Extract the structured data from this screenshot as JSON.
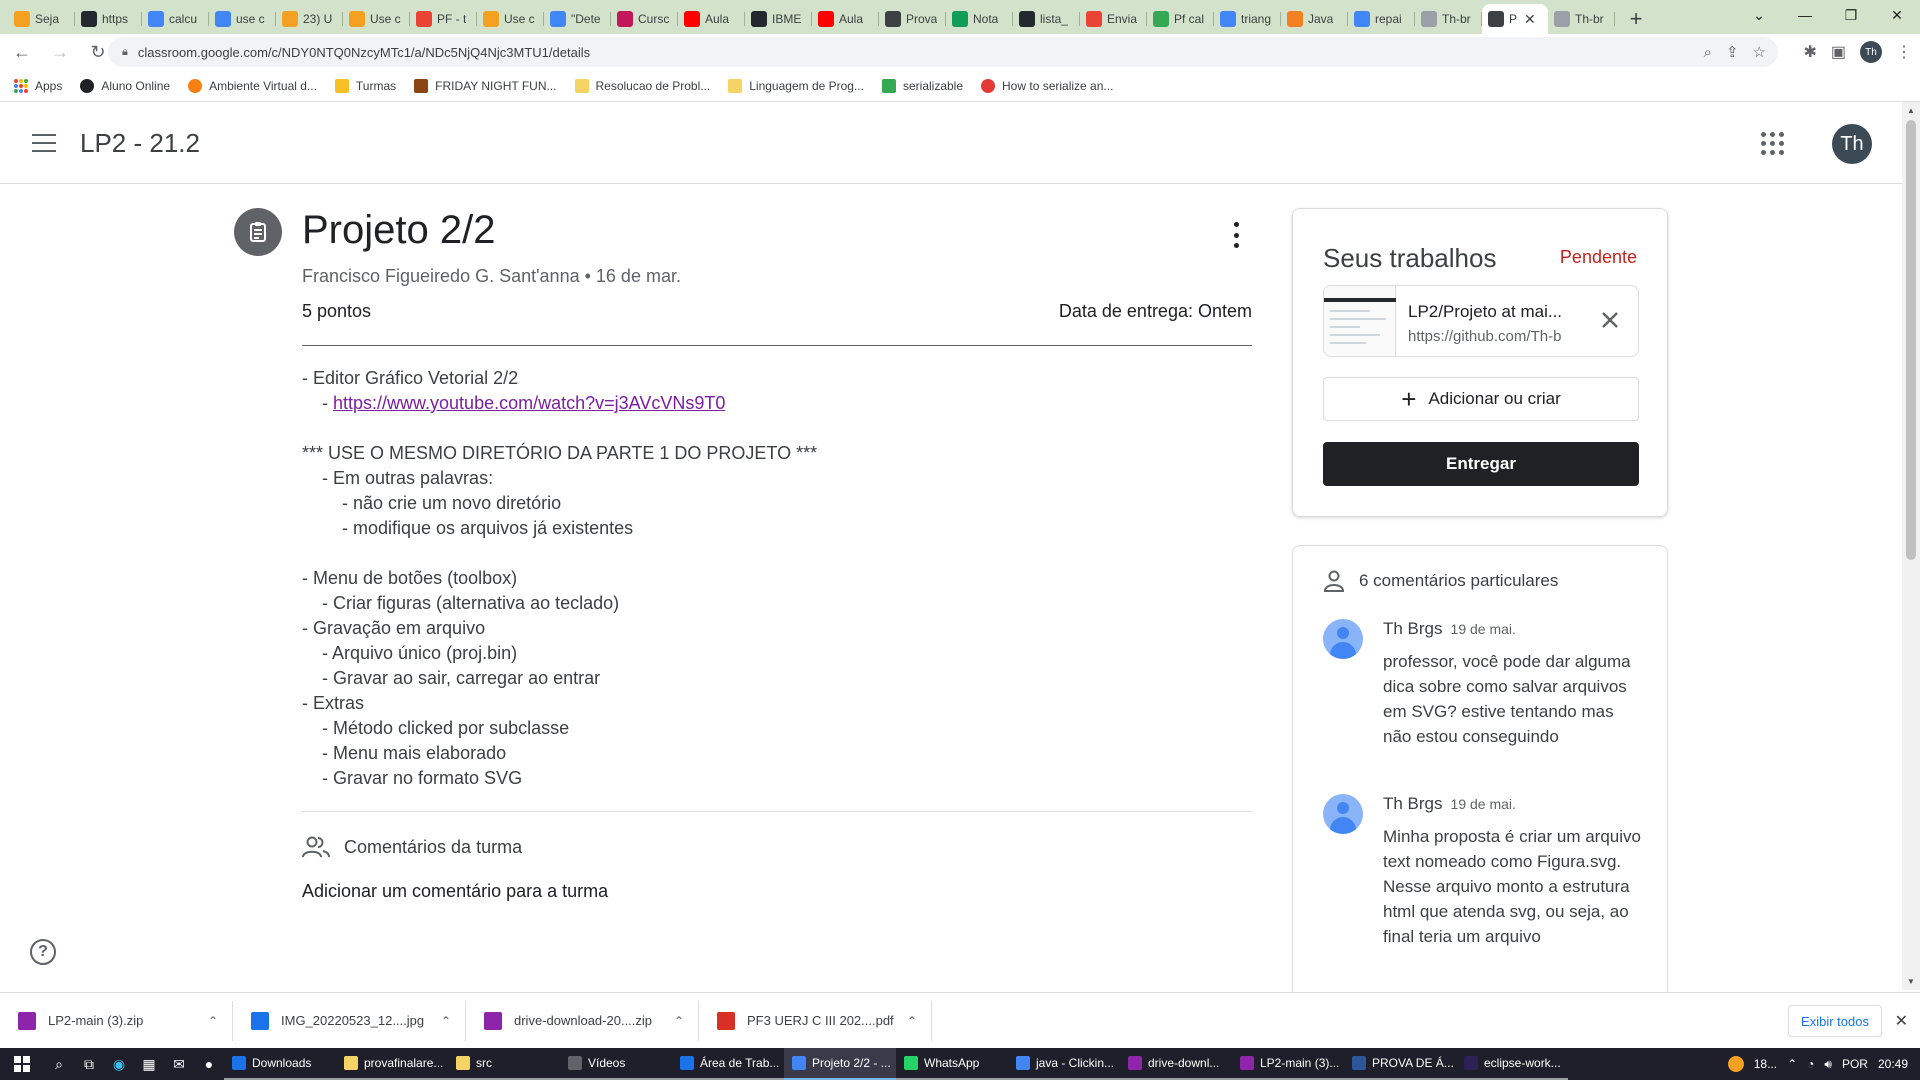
{
  "browser": {
    "tabs": [
      {
        "label": "Seja",
        "icon": "cloud-icon",
        "color": "#f4a020"
      },
      {
        "label": "https",
        "icon": "github-icon",
        "color": "#24292f"
      },
      {
        "label": "calcu",
        "icon": "google-icon",
        "color": "#4285f4"
      },
      {
        "label": "use c",
        "icon": "google-icon",
        "color": "#4285f4"
      },
      {
        "label": "23) U",
        "icon": "cloud-icon",
        "color": "#f4a020"
      },
      {
        "label": "Use c",
        "icon": "cloud-icon",
        "color": "#f4a020"
      },
      {
        "label": "PF - t",
        "icon": "gmail-icon",
        "color": "#ea4335"
      },
      {
        "label": "Use c",
        "icon": "cloud-icon",
        "color": "#f4a020"
      },
      {
        "label": "\"Dete",
        "icon": "google-icon",
        "color": "#4285f4"
      },
      {
        "label": "Cursc",
        "icon": "globe-icon",
        "color": "#c2185b"
      },
      {
        "label": "Aula",
        "icon": "youtube-icon",
        "color": "#ff0000"
      },
      {
        "label": "IBME",
        "icon": "github-icon",
        "color": "#24292f"
      },
      {
        "label": "Aula",
        "icon": "youtube-icon",
        "color": "#ff0000"
      },
      {
        "label": "Prova",
        "icon": "classroom-icon",
        "color": "#3c4043"
      },
      {
        "label": "Nota",
        "icon": "sheets-icon",
        "color": "#0f9d58"
      },
      {
        "label": "lista_",
        "icon": "github-icon",
        "color": "#24292f"
      },
      {
        "label": "Envia",
        "icon": "gmail-icon",
        "color": "#ea4335"
      },
      {
        "label": "Pf cal",
        "icon": "drive-icon",
        "color": "#34a853"
      },
      {
        "label": "triang",
        "icon": "google-icon",
        "color": "#4285f4"
      },
      {
        "label": "Java",
        "icon": "stackoverflow-icon",
        "color": "#f48024"
      },
      {
        "label": "repai",
        "icon": "google-icon",
        "color": "#4285f4"
      },
      {
        "label": "Th-br",
        "icon": "github-icon",
        "color": "#9aa0a6"
      },
      {
        "label": "P",
        "icon": "classroom-icon",
        "color": "#3c4043",
        "active": true
      },
      {
        "label": "Th-br",
        "icon": "github-icon",
        "color": "#9aa0a6"
      }
    ],
    "url": "classroom.google.com/c/NDY0NTQ0NzcyMTc1/a/NDc5NjQ4Njc3MTU1/details",
    "profile_initials": "Th",
    "bookmarks": [
      {
        "label": "Apps",
        "icon": "apps-grid-icon"
      },
      {
        "label": "Aluno Online",
        "icon": "globe-icon",
        "color": "#202124"
      },
      {
        "label": "Ambiente Virtual d...",
        "icon": "moodle-icon",
        "color": "#f98012"
      },
      {
        "label": "Turmas",
        "icon": "classroom-icon",
        "color": "#f6c026"
      },
      {
        "label": "FRIDAY NIGHT FUN...",
        "icon": "fnf-icon",
        "color": "#8b4513"
      },
      {
        "label": "Resolucao de Probl...",
        "icon": "folder-icon",
        "color": "#f6d365"
      },
      {
        "label": "Linguagem de Prog...",
        "icon": "folder-icon",
        "color": "#f6d365"
      },
      {
        "label": "serializable",
        "icon": "serializable-icon",
        "color": "#34a853"
      },
      {
        "label": "How to serialize an...",
        "icon": "tutorial-icon",
        "color": "#e53935"
      }
    ]
  },
  "classroom": {
    "class_name": "LP2 - 21.2",
    "user_initials": "Th"
  },
  "assignment": {
    "title": "Projeto 2/2",
    "author": "Francisco Figueiredo G. Sant'anna",
    "date": "16 de mar.",
    "points": "5 pontos",
    "due": "Data de entrega: Ontem",
    "description": {
      "line1": "- Editor Gráfico Vetorial 2/2",
      "link_prefix": "    - ",
      "link": "https://www.youtube.com/watch?v=j3AVcVNs9T0",
      "rest": "\n*** USE O MESMO DIRETÓRIO DA PARTE 1 DO PROJETO ***\n    - Em outras palavras:\n        - não crie um novo diretório\n        - modifique os arquivos já existentes\n\n- Menu de botões (toolbox)\n    - Criar figuras (alternativa ao teclado)\n- Gravação em arquivo\n    - Arquivo único (proj.bin)\n    - Gravar ao sair, carregar ao entrar\n- Extras\n    - Método clicked por subclasse\n    - Menu mais elaborado\n    - Gravar no formato SVG"
    },
    "class_comments_label": "Comentários da turma",
    "add_class_comment": "Adicionar um comentário para a turma"
  },
  "your_work": {
    "title": "Seus trabalhos",
    "status": "Pendente",
    "status_color": "#c5221f",
    "attachment": {
      "title": "LP2/Projeto at mai...",
      "url": "https://github.com/Th-b"
    },
    "add_or_create": "Adicionar ou criar",
    "turn_in": "Entregar"
  },
  "private_comments": {
    "header": "6 comentários particulares",
    "comments": [
      {
        "author": "Th Brgs",
        "date": "19 de mai.",
        "text": "professor, você pode dar alguma dica sobre como salvar arquivos em SVG? estive tentando mas não estou conseguindo"
      },
      {
        "author": "Th Brgs",
        "date": "19 de mai.",
        "text": "Minha proposta é criar um arquivo text nomeado como Figura.svg.\nNesse arquivo monto a estrutura html que atenda svg, ou seja, ao final teria um arquivo"
      }
    ]
  },
  "downloads": {
    "items": [
      {
        "name": "LP2-main (3).zip",
        "icon": "winrar-icon",
        "color": "#8e24aa"
      },
      {
        "name": "IMG_20220523_12....jpg",
        "icon": "image-file-icon",
        "color": "#1a73e8"
      },
      {
        "name": "drive-download-20....zip",
        "icon": "winrar-icon",
        "color": "#8e24aa"
      },
      {
        "name": "PF3  UERJ C III 202....pdf",
        "icon": "pdf-icon",
        "color": "#d93025"
      }
    ],
    "show_all": "Exibir todos"
  },
  "taskbar": {
    "apps": [
      {
        "label": "Downloads",
        "color": "#1a73e8",
        "icon": "download-arrow-icon"
      },
      {
        "label": "provafinalare...",
        "color": "#f6d365",
        "icon": "folder-icon"
      },
      {
        "label": "src",
        "color": "#f6d365",
        "icon": "folder-icon"
      },
      {
        "label": "Vídeos",
        "color": "#5f6368",
        "icon": "video-folder-icon"
      },
      {
        "label": "Área de Trab...",
        "color": "#1a73e8",
        "icon": "desktop-folder-icon"
      },
      {
        "label": "Projeto 2/2 - ...",
        "color": "#4285f4",
        "icon": "chrome-icon",
        "active": true
      },
      {
        "label": "WhatsApp",
        "color": "#25d366",
        "icon": "whatsapp-icon"
      },
      {
        "label": "java - Clickin...",
        "color": "#4285f4",
        "icon": "chrome-icon"
      },
      {
        "label": "drive-downl...",
        "color": "#8e24aa",
        "icon": "winrar-icon"
      },
      {
        "label": "LP2-main (3)...",
        "color": "#8e24aa",
        "icon": "winrar-icon"
      },
      {
        "label": "PROVA DE Á...",
        "color": "#2b579a",
        "icon": "word-icon"
      },
      {
        "label": "eclipse-work...",
        "color": "#2c2255",
        "icon": "eclipse-icon"
      }
    ],
    "weather": "18...",
    "language": "POR",
    "time": "20:49"
  }
}
